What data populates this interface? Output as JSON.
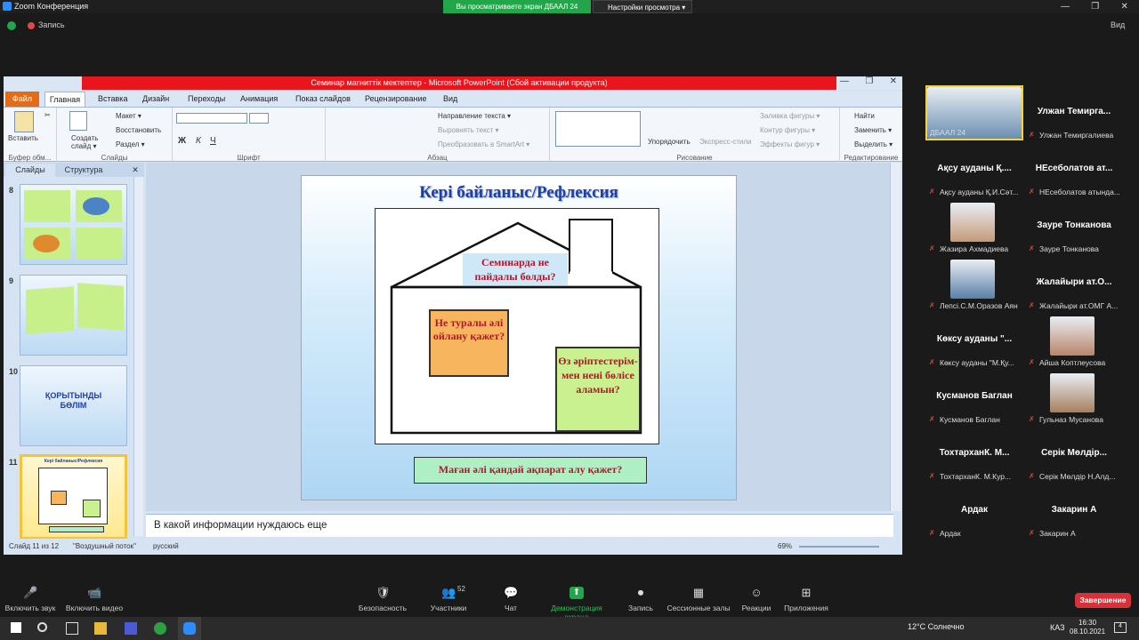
{
  "zoom": {
    "window_title": "Zoom Конференция",
    "share_banner": "Вы просматриваете экран ДБААЛ 24",
    "view_options": "Настройки просмотра ▾",
    "record_label": "Запись",
    "view_label": "Вид",
    "toolbar": [
      {
        "id": "mute",
        "label": "Включить звук",
        "icon": "🎤"
      },
      {
        "id": "video",
        "label": "Включить видео",
        "icon": "📹"
      },
      {
        "id": "security",
        "label": "Безопасность",
        "icon": "🛡"
      },
      {
        "id": "participants",
        "label": "Участники",
        "icon": "👥",
        "count": "52"
      },
      {
        "id": "chat",
        "label": "Чат",
        "icon": "💬"
      },
      {
        "id": "share",
        "label": "Демонстрация экрана",
        "icon": "⬆"
      },
      {
        "id": "record",
        "label": "Запись",
        "icon": "⏺"
      },
      {
        "id": "breakout",
        "label": "Сессионные залы",
        "icon": "▦"
      },
      {
        "id": "reactions",
        "label": "Реакции",
        "icon": "☺"
      },
      {
        "id": "apps",
        "label": "Приложения",
        "icon": "⊞"
      }
    ],
    "end_button": "Завершение",
    "participants": [
      {
        "name": "",
        "label": "ДБААЛ 24",
        "has_video": true
      },
      {
        "name": "Улжан  Темирга...",
        "label": "Улжан Темиргалиева",
        "has_video": false
      },
      {
        "name": "Ақсу ауданы Қ....",
        "label": "Ақсу ауданы Қ.И.Сәт...",
        "has_video": false
      },
      {
        "name": "НЕсеболатов  ат...",
        "label": "НЕсеболатов атында...",
        "has_video": false
      },
      {
        "name": "",
        "label": "Жазира Ахмадиева",
        "has_video": true
      },
      {
        "name": "Зауре Тонканова",
        "label": "Зауре Тонканова",
        "has_video": false
      },
      {
        "name": "",
        "label": "Лепсі.С.М.Оразов Аян",
        "has_video": true
      },
      {
        "name": "Жалайыри  ат.О...",
        "label": "Жалайыри ат.ОМГ А...",
        "has_video": false
      },
      {
        "name": "Көксу ауданы \"...",
        "label": "Көксу ауданы \"М.Қу...",
        "has_video": false
      },
      {
        "name": "",
        "label": "Айша Коптлеусова",
        "has_video": true
      },
      {
        "name": "Кусманов Баглан",
        "label": "Кусманов Баглан",
        "has_video": false
      },
      {
        "name": "",
        "label": "Гульназ Мусанова",
        "has_video": true
      },
      {
        "name": "ТохтарханК.   М...",
        "label": "ТохтарханК.  М.Кур...",
        "has_video": false
      },
      {
        "name": "Серік Мөлдір...",
        "label": "Серік Мөлдір  Н.Алд...",
        "has_video": false
      },
      {
        "name": "Ардак",
        "label": "Ардак",
        "has_video": false
      },
      {
        "name": "Закарин А",
        "label": "Закарин А",
        "has_video": false
      }
    ]
  },
  "ppt": {
    "title": "Семинар магниттік мектептер  -  Microsoft PowerPoint (Сбой активации продукта)",
    "tabs": [
      "Файл",
      "Главная",
      "Вставка",
      "Дизайн",
      "Переходы",
      "Анимация",
      "Показ слайдов",
      "Рецензирование",
      "Вид"
    ],
    "ribbon": {
      "paste": "Вставить",
      "create_slide": "Создать слайд ▾",
      "layout": "Макет ▾",
      "restore": "Восстановить",
      "section": "Раздел ▾",
      "clipboard_group": "Буфер обм...",
      "slides_group": "Слайды",
      "font_group": "Шрифт",
      "paragraph_group": "Абзац",
      "drawing_group": "Рисование",
      "editing_group": "Редактирование",
      "text_direction": "Направление текста ▾",
      "align_text": "Выровнять текст ▾",
      "smartart": "Преобразовать в SmartArt ▾",
      "arrange": "Упорядочить",
      "express_styles": "Экспресс-стили",
      "shape_fill": "Заливка фигуры ▾",
      "shape_outline": "Контур фигуры ▾",
      "shape_effects": "Эффекты фигур ▾",
      "find": "Найти",
      "replace": "Заменить ▾",
      "select": "Выделить ▾"
    },
    "pane_tabs": [
      "Слайды",
      "Структура"
    ],
    "slides": [
      {
        "num": "8",
        "text": ""
      },
      {
        "num": "9",
        "text": ""
      },
      {
        "num": "10",
        "text": "ҚОРЫТЫНДЫ БӨЛІМ"
      },
      {
        "num": "11",
        "text": "Кері байланыс/Рефлексия"
      }
    ],
    "current_slide": {
      "title": "Кері байланыс/Рефлексия",
      "roof": "Семинарда   не пайдалы болды?",
      "left": "Не туралы әлі ойлану қажет?",
      "right": "Өз әріптестерім-мен нені бөлісе аламын?",
      "bottom": "Маған әлі қандай ақпарат алу қажет?"
    },
    "notes": "В какой информации нуждаюсь еще",
    "status": {
      "slide": "Слайд 11 из 12",
      "theme": "\"Воздушный поток\"",
      "lang": "русский",
      "zoom": "69%"
    }
  },
  "taskbar": {
    "weather": "12°C  Солнечно",
    "lang": "КАЗ",
    "time": "16:30",
    "date": "08.10.2021",
    "notif": "4"
  }
}
